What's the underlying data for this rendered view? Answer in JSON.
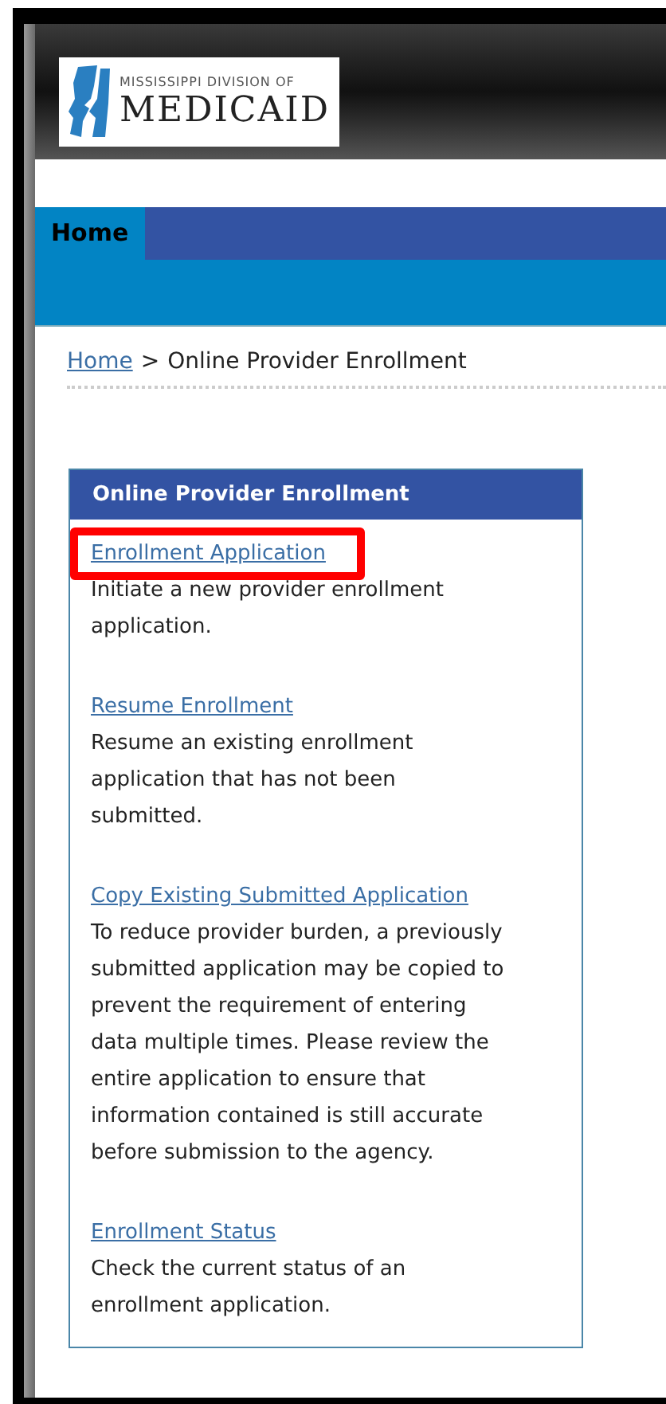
{
  "logo": {
    "line_1": "MISSISSIPPI DIVISION OF",
    "line_2": "MEDICAID"
  },
  "nav": {
    "tabs": [
      {
        "label": "Home",
        "selected": true
      }
    ]
  },
  "breadcrumb": {
    "link": "Home",
    "separator": ">",
    "current": "Online Provider Enrollment"
  },
  "panel": {
    "title": "Online Provider Enrollment",
    "items": [
      {
        "link": "Enrollment Application",
        "description": "Initiate a new provider enrollment application.",
        "highlighted": true
      },
      {
        "link": "Resume Enrollment",
        "description": "Resume an existing enrollment application that has not been submitted.",
        "highlighted": false
      },
      {
        "link": "Copy Existing Submitted Application",
        "description": "To reduce provider burden, a previously submitted application may be copied to prevent the requirement of entering data multiple times. Please review the entire application to ensure that information contained is still accurate before submission to the agency.",
        "highlighted": false
      },
      {
        "link": "Enrollment Status",
        "description": "Check the current status of an enrollment application.",
        "highlighted": false
      }
    ]
  }
}
